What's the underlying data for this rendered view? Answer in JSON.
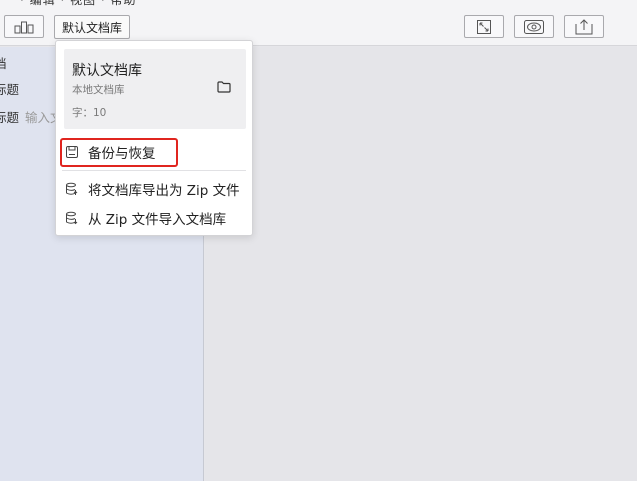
{
  "toolbar": {
    "cutoff_menu_text": "· 编辑 · 视图 · 帮助",
    "library_button_label": "默认文档库",
    "icons": [
      "library-stats-icon",
      "expand-icon",
      "preview-eye-icon",
      "share-upload-icon"
    ]
  },
  "sidebar": {
    "rows": [
      {
        "label": "档",
        "muted": ""
      },
      {
        "label": "标题",
        "muted": ""
      },
      {
        "label": "标题",
        "muted": "输入文"
      }
    ]
  },
  "library_menu": {
    "card": {
      "name": "默认文档库",
      "type": "本地文档库",
      "count": "字：10"
    },
    "items": [
      {
        "label": "备份与恢复",
        "icon": "save-disk-icon"
      },
      {
        "label": "将文档库导出为 Zip 文件",
        "icon": "database-export-icon"
      },
      {
        "label": "从 Zip 文件导入文档库",
        "icon": "database-import-icon"
      }
    ]
  },
  "colors": {
    "highlight": "#e0251f",
    "sidebar_bg": "#dfe3ef",
    "main_bg": "#e5e5e9"
  }
}
